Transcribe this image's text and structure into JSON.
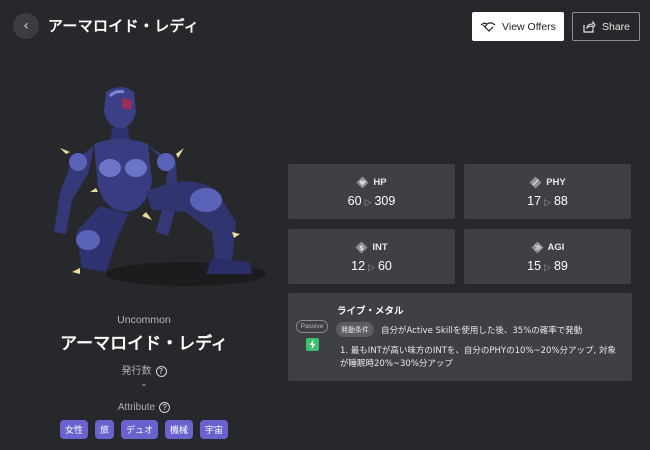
{
  "header": {
    "title": "アーマロイド・レディ",
    "view_offers_label": "View Offers",
    "share_label": "Share"
  },
  "character": {
    "rarity": "Uncommon",
    "name": "アーマロイド・レディ",
    "issue_label": "発行数",
    "issue_value": "-",
    "attribute_label": "Attribute",
    "attributes": [
      "女性",
      "旅",
      "デュオ",
      "機械",
      "宇宙"
    ]
  },
  "stats": {
    "hp": {
      "label": "HP",
      "from": "60",
      "to": "309"
    },
    "phy": {
      "label": "PHY",
      "from": "17",
      "to": "88"
    },
    "int": {
      "label": "INT",
      "from": "12",
      "to": "60"
    },
    "agi": {
      "label": "AGI",
      "from": "15",
      "to": "89"
    }
  },
  "skill": {
    "name": "ライブ・メタル",
    "type": "Passive",
    "condition_badge": "発動条件",
    "condition_text": "自分がActive Skillを使用した後、35%の確率で発動",
    "effect": "1. 最もINTが高い味方のINTを、自分のPHYの10%~20%分アップ, 対象が睡眠時20%~30%分アップ"
  },
  "icons": {
    "back": "chevron-left-icon",
    "view_offers": "handshake-icon",
    "share": "share-icon",
    "skill": "passive-skill-icon"
  },
  "colors": {
    "background": "#27282b",
    "card": "#3f4045",
    "tag": "#6a63cf",
    "skill_icon": "#3cbf6a"
  }
}
